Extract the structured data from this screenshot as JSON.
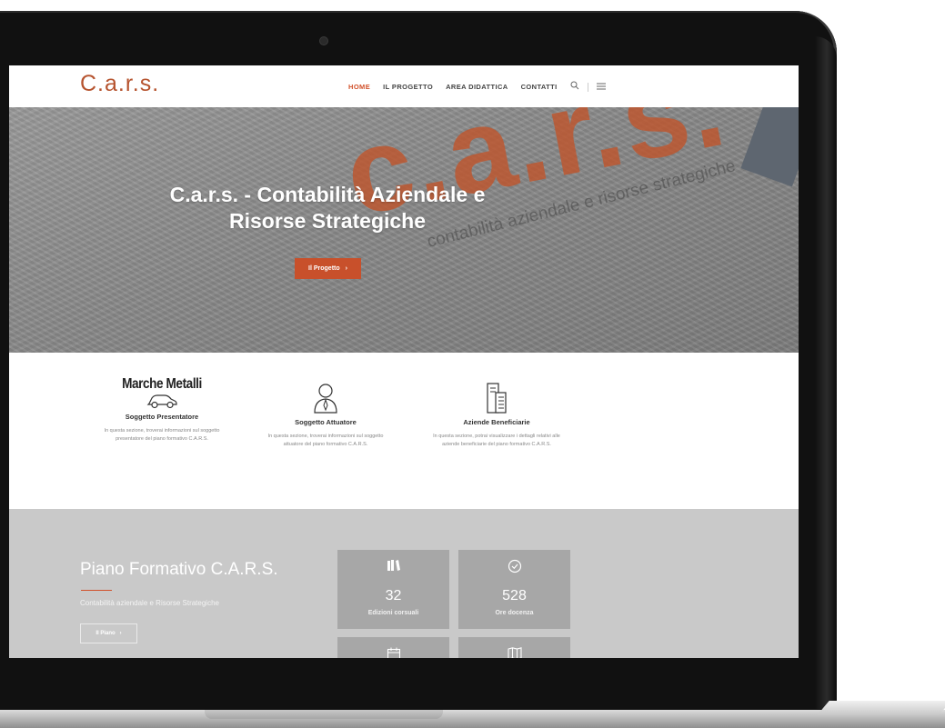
{
  "header": {
    "logo": "C.a.r.s.",
    "nav": [
      {
        "label": "HOME",
        "active": true
      },
      {
        "label": "IL PROGETTO",
        "active": false
      },
      {
        "label": "AREA DIDATTICA",
        "active": false
      },
      {
        "label": "CONTATTI",
        "active": false
      }
    ],
    "icons": [
      "search-icon",
      "menu-icon"
    ],
    "accent_color": "#d1502a"
  },
  "hero": {
    "watermark": "c.a.r.s.",
    "watermark_sub": "contabilità aziendale e risorse strategiche",
    "title": "C.a.r.s. - Contabilità Aziendale e Risorse Strategiche",
    "button_label": "Il Progetto",
    "button_arrow": "›"
  },
  "features": [
    {
      "brand": "Marche Metalli",
      "icon": "car-icon",
      "title": "Soggetto Presentatore",
      "description": "In questa sezione, troverai informazioni sul soggetto presentatore del piano formativo C.A.R.S."
    },
    {
      "brand": "",
      "icon": "person-icon",
      "title": "Soggetto Attuatore",
      "description": "In questa sezione, troverai informazioni sul soggetto attuatore del piano formativo C.A.R.S."
    },
    {
      "brand": "",
      "icon": "building-icon",
      "title": "Aziende Beneficiarie",
      "description": "In questa sezione, potrai visualizzare i dettagli relativi alle aziende beneficiarie del piano formativo C.A.R.S."
    }
  ],
  "plan": {
    "title": "Piano Formativo C.A.R.S.",
    "subtitle": "Contabilità aziendale e Risorse Strategiche",
    "button_label": "Il Piano",
    "button_arrow": "›",
    "stats": [
      {
        "icon": "books-icon",
        "value": "32",
        "label": "Edizioni corsuali"
      },
      {
        "icon": "clock-icon",
        "value": "528",
        "label": "Ore docenza"
      },
      {
        "icon": "calendar-icon",
        "value": "",
        "label": ""
      },
      {
        "icon": "map-icon",
        "value": "",
        "label": ""
      }
    ]
  }
}
